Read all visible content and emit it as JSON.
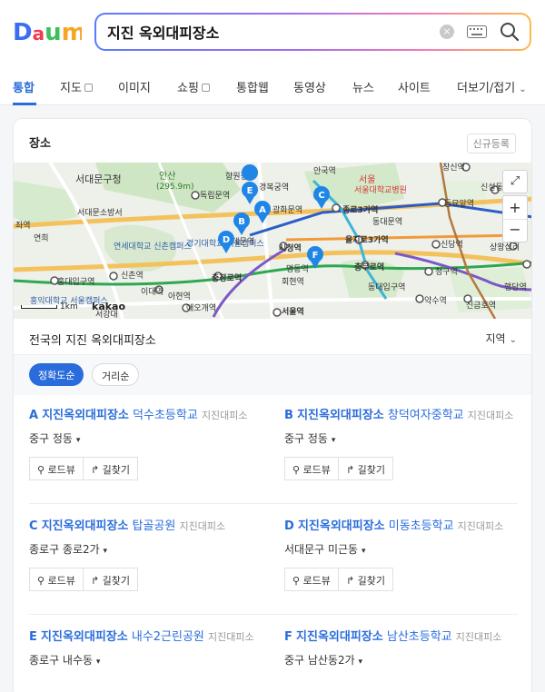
{
  "search": {
    "query": "지진 옥외대피장소"
  },
  "tabs": [
    {
      "label": "통합"
    },
    {
      "label": "지도"
    },
    {
      "label": "이미지"
    },
    {
      "label": "쇼핑"
    },
    {
      "label": "통합웹"
    },
    {
      "label": "동영상"
    },
    {
      "label": "뉴스"
    },
    {
      "label": "사이트"
    },
    {
      "label": "더보기/접기"
    }
  ],
  "card": {
    "title": "장소",
    "new_registration": "신규등록"
  },
  "map": {
    "labels": {
      "seodaemun_gu": "서대문구청",
      "ansan": "안산",
      "ansan_height": "(295.9m)",
      "hyangwon": "향원정",
      "seodaemun_hall": "서대문소방서",
      "dongnimmun": "독립문역",
      "gyeongbok": "경복궁역",
      "gwanghwamun": "광화문역",
      "anguk": "안국역",
      "jongno3": "종로3가역",
      "jongno": "종로",
      "dongdaemun": "동대문역",
      "changsin": "창신역",
      "seoul_univ_hosp": "서울대학교병원",
      "seoul_label": "서울",
      "sinseol": "신설동",
      "dongmyo": "동묘앞역",
      "yonsei": "연세대학교 신촌캠퍼스",
      "kyunghee": "경기대학교 서울캠퍼스",
      "city_hall": "시청역",
      "euljiro3": "을지로3가역",
      "sindang": "신당역",
      "sangwangsimni": "상왕십리",
      "seodaemun_stn": "서대문역",
      "myeongdong": "명동역",
      "chungmuro": "충무로역",
      "cheonggu": "청구역",
      "chungjeongno": "충정로역",
      "hoehyeon": "회현역",
      "dongdaeipgu": "동대입구역",
      "yaksu": "약수역",
      "sinchon": "신촌역",
      "ewha": "이대역",
      "ahyeon": "아현역",
      "hongdae": "홍대입구역",
      "seoul_stn": "서울역",
      "aeogae": "애오개역",
      "hongik_univ": "홍익대학교 서울캠퍼스",
      "seogang": "서강대",
      "sindang_stn": "신금호역",
      "haengdang": "행당역",
      "yeonhui": "연희",
      "lst_station": "좌역"
    },
    "markers": [
      "A",
      "B",
      "C",
      "D",
      "E",
      "F"
    ],
    "scale": "1km",
    "brand": "kakao"
  },
  "region": {
    "title": "전국의 지진 옥외대피장소",
    "select": "지역"
  },
  "sort": {
    "accuracy": "정확도순",
    "distance": "거리순"
  },
  "results": [
    {
      "letter": "A",
      "name": "지진옥외대피장소",
      "sub": "덕수초등학교",
      "cat": "지진대피소",
      "addr": "중구 정동"
    },
    {
      "letter": "B",
      "name": "지진옥외대피장소",
      "sub": "창덕여자중학교",
      "cat": "지진대피소",
      "addr": "중구 정동"
    },
    {
      "letter": "C",
      "name": "지진옥외대피장소",
      "sub": "탑골공원",
      "cat": "지진대피소",
      "addr": "종로구 종로2가"
    },
    {
      "letter": "D",
      "name": "지진옥외대피장소",
      "sub": "미동초등학교",
      "cat": "지진대피소",
      "addr": "서대문구 미근동"
    },
    {
      "letter": "E",
      "name": "지진옥외대피장소",
      "sub": "내수2근린공원",
      "cat": "지진대피소",
      "addr": "종로구 내수동"
    },
    {
      "letter": "F",
      "name": "지진옥외대피장소",
      "sub": "남산초등학교",
      "cat": "지진대피소",
      "addr": "중구 남산동2가"
    }
  ],
  "actions": {
    "roadview": "로드뷰",
    "directions": "길찾기"
  },
  "colors": {
    "accent": "#2a6cdc",
    "marker": "#1f86e8"
  }
}
